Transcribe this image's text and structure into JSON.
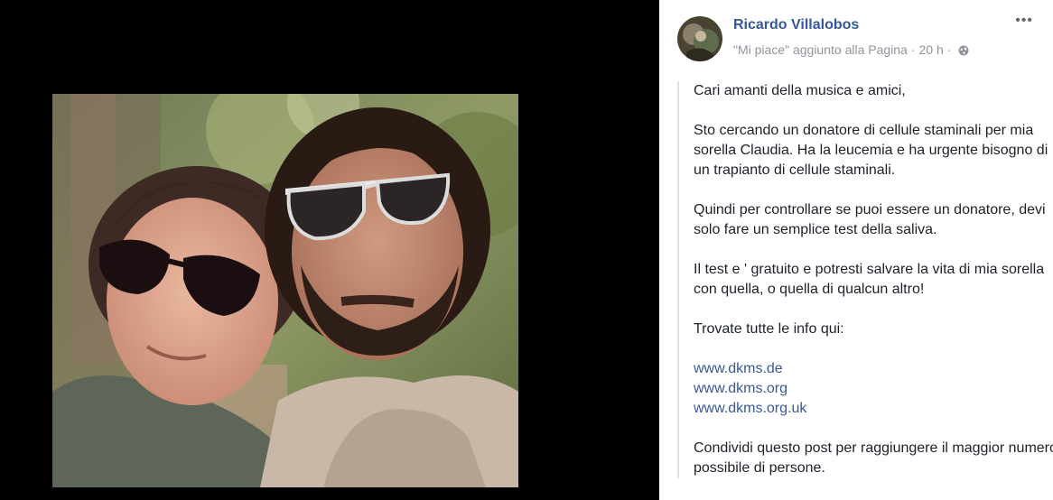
{
  "post": {
    "author": "Ricardo Villalobos",
    "meta_text": "\"Mi piace\" aggiunto alla Pagina",
    "meta_sep": "·",
    "time": "20 h",
    "more_label": "•••",
    "paragraphs": [
      "Cari amanti della musica e amici,",
      "Sto cercando un donatore di cellule staminali per mia sorella Claudia. Ha la leucemia e ha urgente bisogno di un trapianto di cellule staminali.",
      "Quindi per controllare se puoi essere un donatore, devi solo fare un semplice test della saliva.",
      "Il test e ' gratuito e potresti salvare la vita di mia sorella con quella, o quella di qualcun altro!",
      "Trovate tutte le info qui:"
    ],
    "links": [
      "www.dkms.de",
      "www.dkms.org",
      "www.dkms.org.uk"
    ],
    "closing": "Condividi questo post per raggiungere il maggior numero possibile di persone."
  },
  "icons": {
    "privacy": "globe-icon",
    "more": "more-options-icon"
  },
  "colors": {
    "link": "#385898",
    "author": "#365899",
    "meta": "#90949c",
    "text": "#1d2129",
    "viewer_bg": "#000000"
  }
}
